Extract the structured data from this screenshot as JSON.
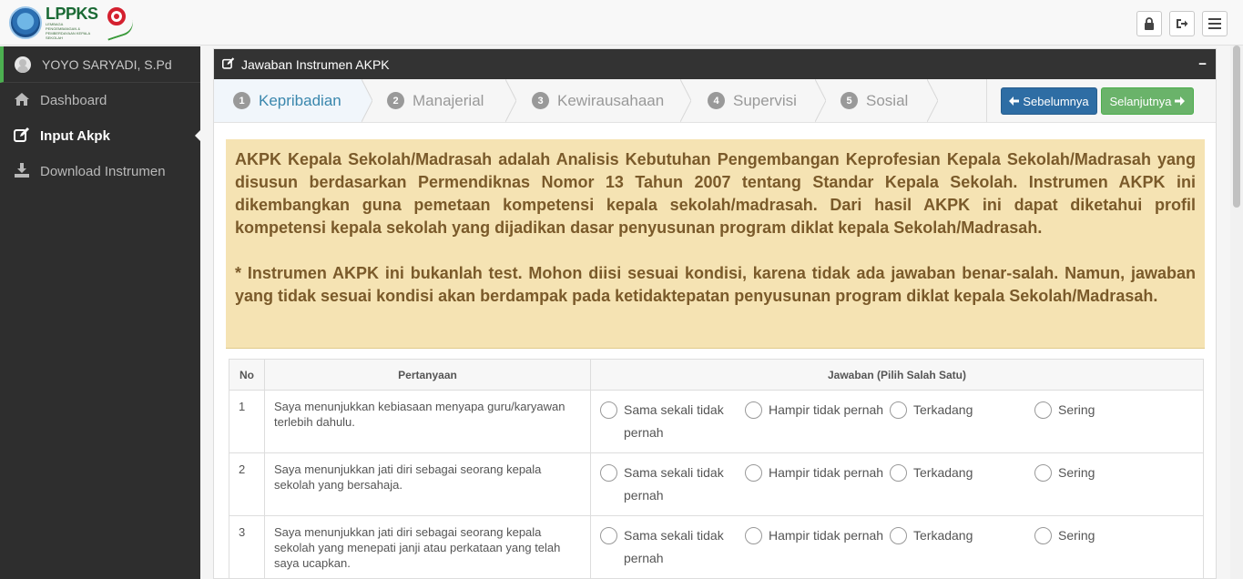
{
  "brand": {
    "logo_text": "LPPKS",
    "logo_subtext": "LEMBAGA PENGEMBANGAN & PEMBERDAYAAN KEPALA SEKOLAH"
  },
  "topbar": {
    "icons": [
      "lock-icon",
      "sign-out-icon",
      "menu-icon"
    ]
  },
  "sidebar": {
    "user_name": "YOYO SARYADI, S.Pd",
    "items": [
      {
        "label": "Dashboard",
        "icon": "home-icon",
        "active": false
      },
      {
        "label": "Input Akpk",
        "icon": "edit-icon",
        "active": true
      },
      {
        "label": "Download Instrumen",
        "icon": "download-icon",
        "active": false
      }
    ]
  },
  "panel": {
    "title": "Jawaban Instrumen AKPK",
    "collapse_symbol": "−"
  },
  "wizard": {
    "steps": [
      {
        "num": "1",
        "label": "Kepribadian",
        "active": true
      },
      {
        "num": "2",
        "label": "Manajerial",
        "active": false
      },
      {
        "num": "3",
        "label": "Kewirausahaan",
        "active": false
      },
      {
        "num": "4",
        "label": "Supervisi",
        "active": false
      },
      {
        "num": "5",
        "label": "Sosial",
        "active": false
      }
    ],
    "prev_label": "Sebelumnya",
    "next_label": "Selanjutnya"
  },
  "note": {
    "paragraph1": "AKPK Kepala Sekolah/Madrasah adalah Analisis Kebutuhan Pengembangan Keprofesian Kepala Sekolah/Madrasah yang disusun berdasarkan Permendiknas Nomor 13 Tahun 2007 tentang Standar Kepala Sekolah. Instrumen AKPK ini dikembangkan guna pemetaan kompetensi kepala sekolah/madrasah. Dari hasil AKPK ini dapat diketahui profil kompetensi kepala sekolah yang dijadikan dasar penyusunan program diklat kepala Sekolah/Madrasah.",
    "paragraph2": "* Instrumen AKPK ini bukanlah test. Mohon diisi sesuai kondisi, karena tidak ada jawaban benar-salah. Namun, jawaban yang tidak sesuai kondisi akan berdampak pada ketidaktepatan penyusunan program diklat kepala Sekolah/Madrasah."
  },
  "table": {
    "headers": {
      "no": "No",
      "question": "Pertanyaan",
      "answer": "Jawaban (Pilih Salah Satu)"
    },
    "options": [
      "Sama sekali tidak pernah",
      "Hampir tidak pernah",
      "Terkadang",
      "Sering"
    ],
    "rows": [
      {
        "no": "1",
        "question": "Saya menunjukkan kebiasaan menyapa guru/karyawan terlebih dahulu."
      },
      {
        "no": "2",
        "question": "Saya menunjukkan jati diri sebagai seorang kepala sekolah yang bersahaja."
      },
      {
        "no": "3",
        "question": "Saya menunjukkan jati diri sebagai seorang kepala sekolah yang menepati janji atau perkataan yang telah saya ucapkan."
      }
    ]
  }
}
